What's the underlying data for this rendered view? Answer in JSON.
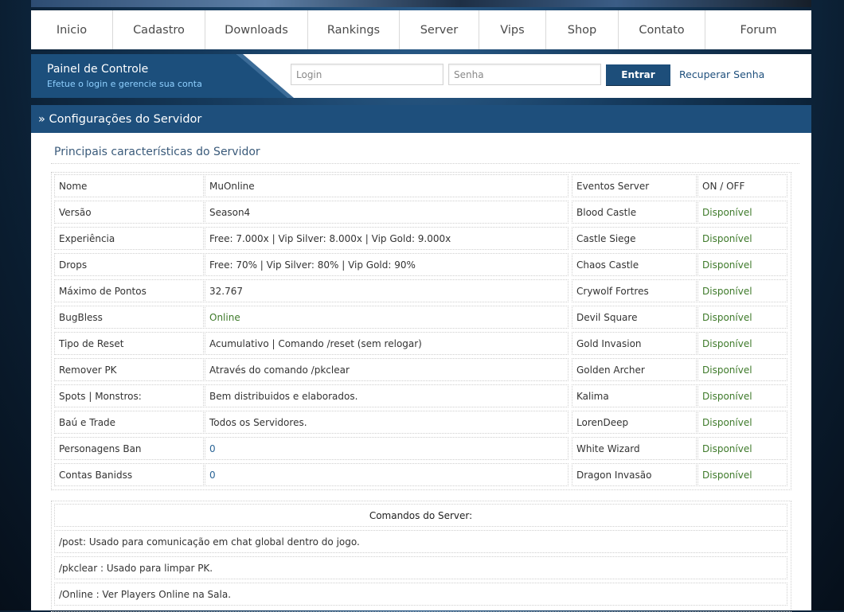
{
  "nav": {
    "items": [
      {
        "label": "Inicio"
      },
      {
        "label": "Cadastro"
      },
      {
        "label": "Downloads"
      },
      {
        "label": "Rankings"
      },
      {
        "label": "Server"
      },
      {
        "label": "Vips"
      },
      {
        "label": "Shop"
      },
      {
        "label": "Contato"
      },
      {
        "label": "Forum"
      }
    ]
  },
  "panel": {
    "title": "Painel de Controle",
    "subtitle": "Efetue o login e gerencie sua conta",
    "login_placeholder": "Login",
    "password_placeholder": "Senha",
    "login_value": "",
    "password_value": "",
    "enter_label": "Entrar",
    "recover_label": "Recuperar Senha"
  },
  "section": {
    "title": "» Configurações do Servidor",
    "subtitle": "Principais características do Servidor"
  },
  "config": {
    "rows": [
      {
        "label": "Nome",
        "value": "MuOnline",
        "event": "Eventos Server",
        "status": "ON / OFF"
      },
      {
        "label": "Versão",
        "value": "Season4",
        "event": "Blood Castle",
        "status": "Disponível"
      },
      {
        "label": "Experiência",
        "value": "Free: 7.000x | Vip Silver: 8.000x | Vip Gold: 9.000x",
        "event": "Castle Siege",
        "status": "Disponível"
      },
      {
        "label": "Drops",
        "value": "Free: 70% | Vip Silver: 80% | Vip Gold: 90%",
        "event": "Chaos Castle",
        "status": "Disponível"
      },
      {
        "label": "Máximo de Pontos",
        "value": "32.767",
        "event": "Crywolf Fortres",
        "status": "Disponível"
      },
      {
        "label": "BugBless",
        "value": "Online",
        "event": "Devil Square",
        "status": "Disponível"
      },
      {
        "label": "Tipo de Reset",
        "value": "Acumulativo | Comando /reset (sem relogar)",
        "event": "Gold Invasion",
        "status": "Disponível"
      },
      {
        "label": "Remover PK",
        "value": "Através do comando /pkclear",
        "event": "Golden Archer",
        "status": "Disponível"
      },
      {
        "label": "Spots | Monstros:",
        "value": "Bem distribuidos e elaborados.",
        "event": "Kalima",
        "status": "Disponível"
      },
      {
        "label": "Baú e Trade",
        "value": "Todos os Servidores.",
        "event": "LorenDeep",
        "status": "Disponível"
      },
      {
        "label": "Personagens Ban",
        "value": "0",
        "event": "White Wizard",
        "status": "Disponível"
      },
      {
        "label": "Contas Banidss",
        "value": "0",
        "event": "Dragon Invasão",
        "status": "Disponível"
      }
    ]
  },
  "commands": {
    "title": "Comandos do Server:",
    "items": [
      "/post: Usado para comunicação em chat global dentro do jogo.",
      "/pkclear : Usado para limpar PK.",
      "/Online : Ver Players Online na Sala."
    ]
  },
  "colors": {
    "accent": "#1e4f7c",
    "available_green": "#3e7a2a",
    "value_blue": "#2a6496"
  }
}
